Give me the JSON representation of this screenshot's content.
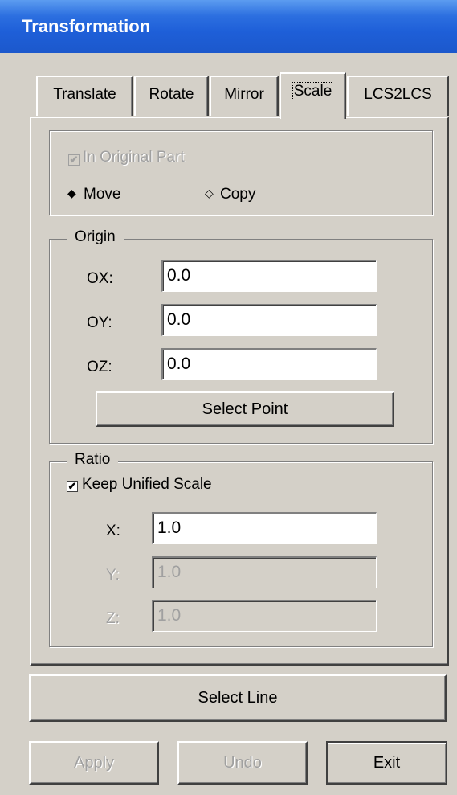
{
  "window": {
    "title": "Transformation"
  },
  "tabs": [
    {
      "label": "Translate"
    },
    {
      "label": "Rotate"
    },
    {
      "label": "Mirror"
    },
    {
      "label": "Scale"
    },
    {
      "label": "LCS2LCS"
    }
  ],
  "active_tab": "Scale",
  "options": {
    "in_original_part": {
      "label": "In Original Part",
      "checked": true,
      "enabled": false
    },
    "mode": [
      {
        "label": "Move",
        "selected": true,
        "glyph": "◆"
      },
      {
        "label": "Copy",
        "selected": false,
        "glyph": "◇"
      }
    ]
  },
  "origin": {
    "legend": "Origin",
    "ox": {
      "label": "OX:",
      "value": "0.0"
    },
    "oy": {
      "label": "OY:",
      "value": "0.0"
    },
    "oz": {
      "label": "OZ:",
      "value": "0.0"
    },
    "select_point": "Select Point"
  },
  "ratio": {
    "legend": "Ratio",
    "keep_unified": {
      "label": "Keep Unified Scale",
      "checked": true,
      "glyph": "✔"
    },
    "x": {
      "label": "X:",
      "value": "1.0",
      "enabled": true
    },
    "y": {
      "label": "Y:",
      "value": "1.0",
      "enabled": false
    },
    "z": {
      "label": "Z:",
      "value": "1.0",
      "enabled": false
    }
  },
  "buttons": {
    "select_line": "Select Line",
    "apply": "Apply",
    "undo": "Undo",
    "exit": "Exit"
  }
}
